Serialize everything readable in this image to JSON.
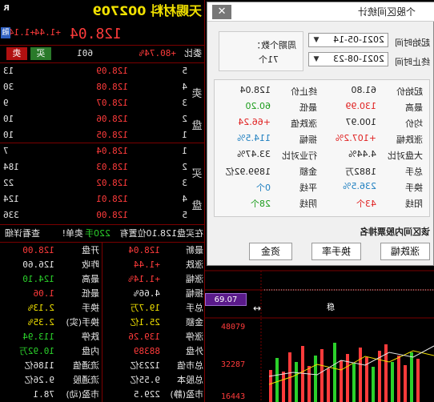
{
  "header": {
    "title": "天赐材料 002709",
    "badge": "R",
    "settings_glyph": "⚙",
    "price": "128.04",
    "change": "+1.44",
    "change_pct": "+1.14%",
    "margin_tag": "融",
    "webi_label": "委比",
    "webi_value": "+80.74%",
    "webi_diff": "601",
    "buy_tab": "买",
    "sell_tab": "卖"
  },
  "sell_side_label": [
    "卖",
    "盘"
  ],
  "buy_side_label": [
    "买",
    "盘"
  ],
  "asks": [
    {
      "level": "5",
      "price": "128.09",
      "volume": "13"
    },
    {
      "level": "4",
      "price": "128.08",
      "volume": "30"
    },
    {
      "level": "3",
      "price": "128.07",
      "volume": "9"
    },
    {
      "level": "2",
      "price": "128.06",
      "volume": "10"
    },
    {
      "level": "1",
      "price": "128.05",
      "volume": "10"
    }
  ],
  "bids": [
    {
      "level": "1",
      "price": "128.04",
      "volume": "7"
    },
    {
      "level": "2",
      "price": "128.03",
      "volume": "184"
    },
    {
      "level": "3",
      "price": "128.02",
      "volume": "22"
    },
    {
      "level": "4",
      "price": "128.01",
      "volume": "124"
    },
    {
      "level": "5",
      "price": "128.00",
      "volume": "336"
    }
  ],
  "trade_bar": {
    "label": "在买盘128.10位置有",
    "volume": "220手",
    "tail": "卖单!",
    "link": "查看详细"
  },
  "stats_left": [
    {
      "label": "最新",
      "value": "128.04",
      "color": "red"
    },
    {
      "label": "涨跌",
      "value": "+1.44",
      "color": "red"
    },
    {
      "label": "涨幅",
      "value": "+1.14%",
      "color": "red"
    },
    {
      "label": "振幅",
      "value": "4.66%",
      "color": "wht"
    },
    {
      "label": "总手",
      "value": "19.7万",
      "color": "yel"
    },
    {
      "label": "金额",
      "value": "25.1亿",
      "color": "yel"
    },
    {
      "label": "涨停",
      "value": "139.26",
      "color": "red"
    },
    {
      "label": "外盘",
      "value": "88389",
      "color": "red"
    },
    {
      "label": "总市值",
      "value": "1223亿",
      "color": "wht"
    },
    {
      "label": "总股本",
      "value": "9.55亿",
      "color": "wht"
    },
    {
      "label": "市盈(静)",
      "value": "229.5",
      "color": "wht"
    }
  ],
  "stats_right": [
    {
      "label": "开盘",
      "value": "128.00",
      "color": "red"
    },
    {
      "label": "昨收",
      "value": "126.60",
      "color": "wht"
    },
    {
      "label": "最高",
      "value": "124.10",
      "color": "grn"
    },
    {
      "label": "最低",
      "value": "1.06",
      "color": "red"
    },
    {
      "label": "换手",
      "value": "2.13%",
      "color": "yel"
    },
    {
      "label": "换手(实)",
      "value": "2.35%",
      "color": "yel"
    },
    {
      "label": "跌停",
      "value": "113.94",
      "color": "grn"
    },
    {
      "label": "内盘",
      "value": "10.92万",
      "color": "grn"
    },
    {
      "label": "流通值",
      "value": "1186亿",
      "color": "wht"
    },
    {
      "label": "流通股",
      "value": "9.26亿",
      "color": "wht"
    },
    {
      "label": "市盈(动)",
      "value": "78.1",
      "color": "wht"
    }
  ],
  "chart": {
    "price_tag": "69.07",
    "marker": "稳",
    "y_labels": [
      "48079",
      "32287",
      "16443"
    ],
    "arrow_glyph": "↔"
  },
  "dialog": {
    "title": "个股区间统计",
    "close_glyph": "✕",
    "start_label": "起始时间",
    "end_label": "终止时间",
    "start_date": "2021-05-14",
    "end_date": "2021-08-23",
    "weekday_label": "周期个数：",
    "weekday_value": "71个",
    "metrics": [
      {
        "label": "起始价",
        "value": "61.80",
        "color": "dk"
      },
      {
        "label": "终止价",
        "value": "128.04",
        "color": "dk"
      },
      {
        "label": "最高",
        "value": "130.99",
        "color": "red"
      },
      {
        "label": "最低",
        "value": "60.20",
        "color": "grn"
      },
      {
        "label": "均价",
        "value": "100.97",
        "color": "dk"
      },
      {
        "label": "涨跌值",
        "value": "+66.24",
        "color": "red"
      },
      {
        "label": "涨跌幅",
        "value": "+107.2%",
        "color": "red"
      },
      {
        "label": "振幅",
        "value": "114.5%",
        "color": "blu"
      },
      {
        "label": "大盘对比",
        "value": "4.44%",
        "color": "dk"
      },
      {
        "label": "行业对比",
        "value": "33.47%",
        "color": "dk"
      },
      {
        "label": "总手",
        "value": "1882万",
        "color": "dk"
      },
      {
        "label": "金额",
        "value": "1899.92亿",
        "color": "dk"
      },
      {
        "label": "换手",
        "value": "236.5%",
        "color": "blu"
      },
      {
        "label": "平线",
        "value": "0个",
        "color": "blu"
      },
      {
        "label": "阳线",
        "value": "43个",
        "color": "red"
      },
      {
        "label": "阴线",
        "value": "28个",
        "color": "grn"
      }
    ],
    "ranking_label": "该区间内股票排名",
    "buttons": [
      "资金",
      "换手率",
      "涨跌幅"
    ]
  }
}
